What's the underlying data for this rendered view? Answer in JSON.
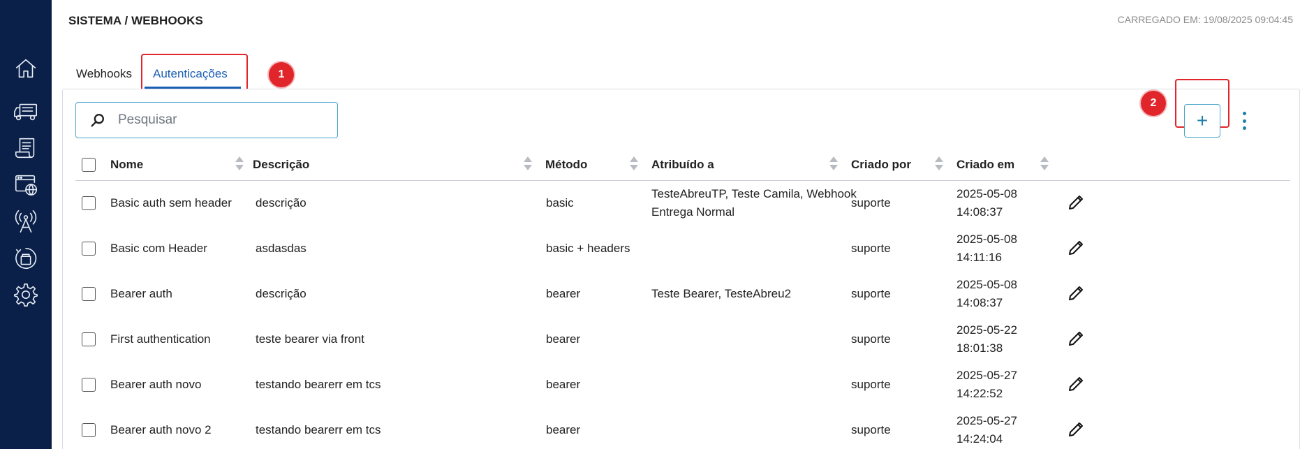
{
  "header": {
    "breadcrumb": "SISTEMA / WEBHOOKS",
    "loaded_at": "CARREGADO EM: 19/08/2025 09:04:45"
  },
  "sidebar": {
    "items": [
      {
        "icon": "home-icon"
      },
      {
        "icon": "truck-icon"
      },
      {
        "icon": "document-icon"
      },
      {
        "icon": "web-globe-icon"
      },
      {
        "icon": "antenna-icon"
      },
      {
        "icon": "integration-icon"
      },
      {
        "icon": "gear-icon"
      }
    ]
  },
  "tabs": [
    {
      "label": "Webhooks",
      "active": false
    },
    {
      "label": "Autenticações",
      "active": true
    }
  ],
  "annotations": [
    {
      "label": "1",
      "target": "tab-autenticacoes"
    },
    {
      "label": "2",
      "target": "add-button"
    }
  ],
  "search": {
    "placeholder": "Pesquisar",
    "value": ""
  },
  "toolbar": {
    "add_label": "+"
  },
  "table": {
    "columns": [
      "Nome",
      "Descrição",
      "Método",
      "Atribuído a",
      "Criado por",
      "Criado em"
    ],
    "rows": [
      {
        "name": "Basic auth sem header",
        "description": "descrição",
        "method": "basic",
        "assigned_line1": "TesteAbreuTP, Teste Camila, Webhook",
        "assigned_line2": "Entrega Normal",
        "created_by": "suporte",
        "created_date": "2025-05-08",
        "created_time": "14:08:37"
      },
      {
        "name": "Basic com Header",
        "description": "asdasdas",
        "method": "basic + headers",
        "assigned_line1": "",
        "assigned_line2": "",
        "created_by": "suporte",
        "created_date": "2025-05-08",
        "created_time": "14:11:16"
      },
      {
        "name": "Bearer auth",
        "description": "descrição",
        "method": "bearer",
        "assigned_line1": "Teste Bearer, TesteAbreu2",
        "assigned_line2": "",
        "created_by": "suporte",
        "created_date": "2025-05-08",
        "created_time": "14:08:37"
      },
      {
        "name": "First authentication",
        "description": "teste bearer via front",
        "method": "bearer",
        "assigned_line1": "",
        "assigned_line2": "",
        "created_by": "suporte",
        "created_date": "2025-05-22",
        "created_time": "18:01:38"
      },
      {
        "name": "Bearer auth novo",
        "description": "testando bearerr em tcs",
        "method": "bearer",
        "assigned_line1": "",
        "assigned_line2": "",
        "created_by": "suporte",
        "created_date": "2025-05-27",
        "created_time": "14:22:52"
      },
      {
        "name": "Bearer auth novo 2",
        "description": "testando bearerr em tcs",
        "method": "bearer",
        "assigned_line1": "",
        "assigned_line2": "",
        "created_by": "suporte",
        "created_date": "2025-05-27",
        "created_time": "14:24:04"
      }
    ]
  },
  "colors": {
    "sidebar_bg": "#0a2048",
    "accent": "#1a5fb4",
    "border_accent": "#4aa6c9",
    "annotation_red": "#e0252b"
  }
}
